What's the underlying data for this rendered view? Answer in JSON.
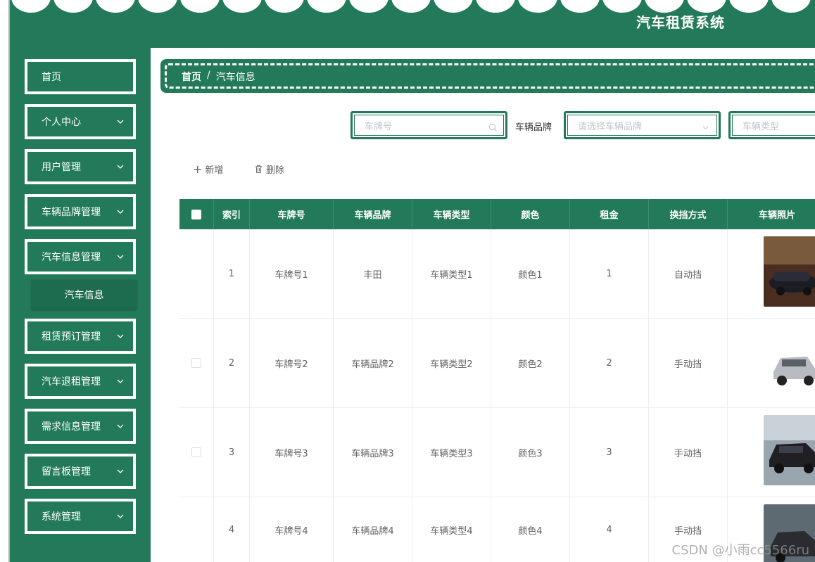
{
  "app": {
    "title": "汽车租赁系统"
  },
  "sidebar": {
    "items": [
      {
        "label": "首页",
        "has_arrow": false
      },
      {
        "label": "个人中心",
        "has_arrow": true
      },
      {
        "label": "用户管理",
        "has_arrow": true
      },
      {
        "label": "车辆品牌管理",
        "has_arrow": true
      },
      {
        "label": "汽车信息管理",
        "has_arrow": true
      },
      {
        "label": "租赁预订管理",
        "has_arrow": true
      },
      {
        "label": "汽车退租管理",
        "has_arrow": true
      },
      {
        "label": "需求信息管理",
        "has_arrow": true
      },
      {
        "label": "留言板管理",
        "has_arrow": true
      },
      {
        "label": "系统管理",
        "has_arrow": true
      }
    ],
    "submenu": {
      "label": "汽车信息"
    }
  },
  "breadcrumb": {
    "home": "首页",
    "separator": "/",
    "current": "汽车信息"
  },
  "search": {
    "plate_placeholder": "车牌号",
    "brand_label": "车辆品牌",
    "brand_placeholder": "请选择车辆品牌",
    "type_placeholder": "车辆类型"
  },
  "toolbar": {
    "add_label": "新增",
    "delete_label": "删除"
  },
  "table": {
    "headers": [
      "索引",
      "车牌号",
      "车辆品牌",
      "车辆类型",
      "颜色",
      "租金",
      "换挡方式",
      "车辆照片"
    ],
    "rows": [
      {
        "index": "1",
        "plate": "车牌号1",
        "brand": "丰田",
        "type": "车辆类型1",
        "color": "颜色1",
        "rent": "1",
        "gear": "自动挡"
      },
      {
        "index": "2",
        "plate": "车牌号2",
        "brand": "车辆品牌2",
        "type": "车辆类型2",
        "color": "颜色2",
        "rent": "2",
        "gear": "手动挡"
      },
      {
        "index": "3",
        "plate": "车牌号3",
        "brand": "车辆品牌3",
        "type": "车辆类型3",
        "color": "颜色3",
        "rent": "3",
        "gear": "手动挡"
      },
      {
        "index": "4",
        "plate": "车牌号4",
        "brand": "车辆品牌4",
        "type": "车辆类型4",
        "color": "颜色4",
        "rent": "4",
        "gear": "手动挡"
      }
    ]
  },
  "watermark": "CSDN @小雨cc5566ru",
  "colors": {
    "primary": "#237a5a",
    "primary_dark": "#1e6c4f",
    "text": "#606266",
    "placeholder": "#c0c4cc"
  }
}
